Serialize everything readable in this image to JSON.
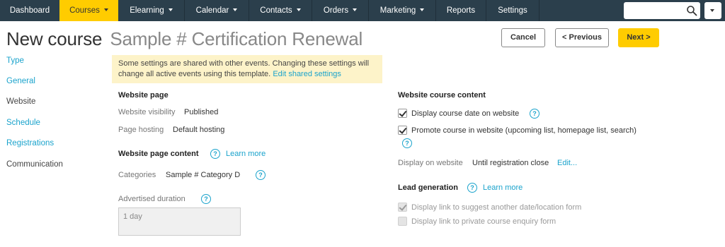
{
  "nav": {
    "items": [
      {
        "label": "Dashboard"
      },
      {
        "label": "Courses"
      },
      {
        "label": "Elearning"
      },
      {
        "label": "Calendar"
      },
      {
        "label": "Contacts"
      },
      {
        "label": "Orders"
      },
      {
        "label": "Marketing"
      },
      {
        "label": "Reports"
      },
      {
        "label": "Settings"
      }
    ],
    "active_item": "Courses",
    "search": {
      "placeholder": "",
      "value": ""
    }
  },
  "header": {
    "title": "New course",
    "subtitle": "Sample # Certification Renewal",
    "cancel_label": "Cancel",
    "previous_label": "< Previous",
    "next_label": "Next >"
  },
  "sidebar": {
    "items": [
      {
        "label": "Type"
      },
      {
        "label": "General"
      },
      {
        "label": "Website"
      },
      {
        "label": "Schedule"
      },
      {
        "label": "Registrations"
      },
      {
        "label": "Communication"
      }
    ],
    "current": "Website"
  },
  "notice": {
    "text": "Some settings are shared with other events. Changing these settings will change all active events using this template.",
    "link": "Edit shared settings"
  },
  "website_page": {
    "title": "Website page",
    "visibility_label": "Website visibility",
    "visibility_value": "Published",
    "hosting_label": "Page hosting",
    "hosting_value": "Default hosting"
  },
  "website_page_content": {
    "title": "Website page content",
    "learn_more": "Learn more",
    "categories_label": "Categories",
    "categories_value": "Sample # Category D",
    "advertised_duration_label": "Advertised duration",
    "advertised_duration_value": "1 day"
  },
  "website_course_content": {
    "title": "Website course content",
    "display_date_label": "Display course date on website",
    "display_date_checked": true,
    "promote_label": "Promote course in website (upcoming list, homepage list, search)",
    "promote_checked": true,
    "display_on_label": "Display on website",
    "display_on_value": "Until registration close",
    "edit_link": "Edit..."
  },
  "lead_generation": {
    "title": "Lead generation",
    "learn_more": "Learn more",
    "suggest_label": "Display link to suggest another date/location form",
    "suggest_checked": true,
    "enquiry_label": "Display link to private course enquiry form",
    "enquiry_checked": false
  },
  "help_glyph": "?",
  "colors": {
    "nav_bg": "#2b3f4c",
    "accent": "#ffcc00",
    "link": "#1aa3cc",
    "notice_bg": "#fdf3c9"
  }
}
